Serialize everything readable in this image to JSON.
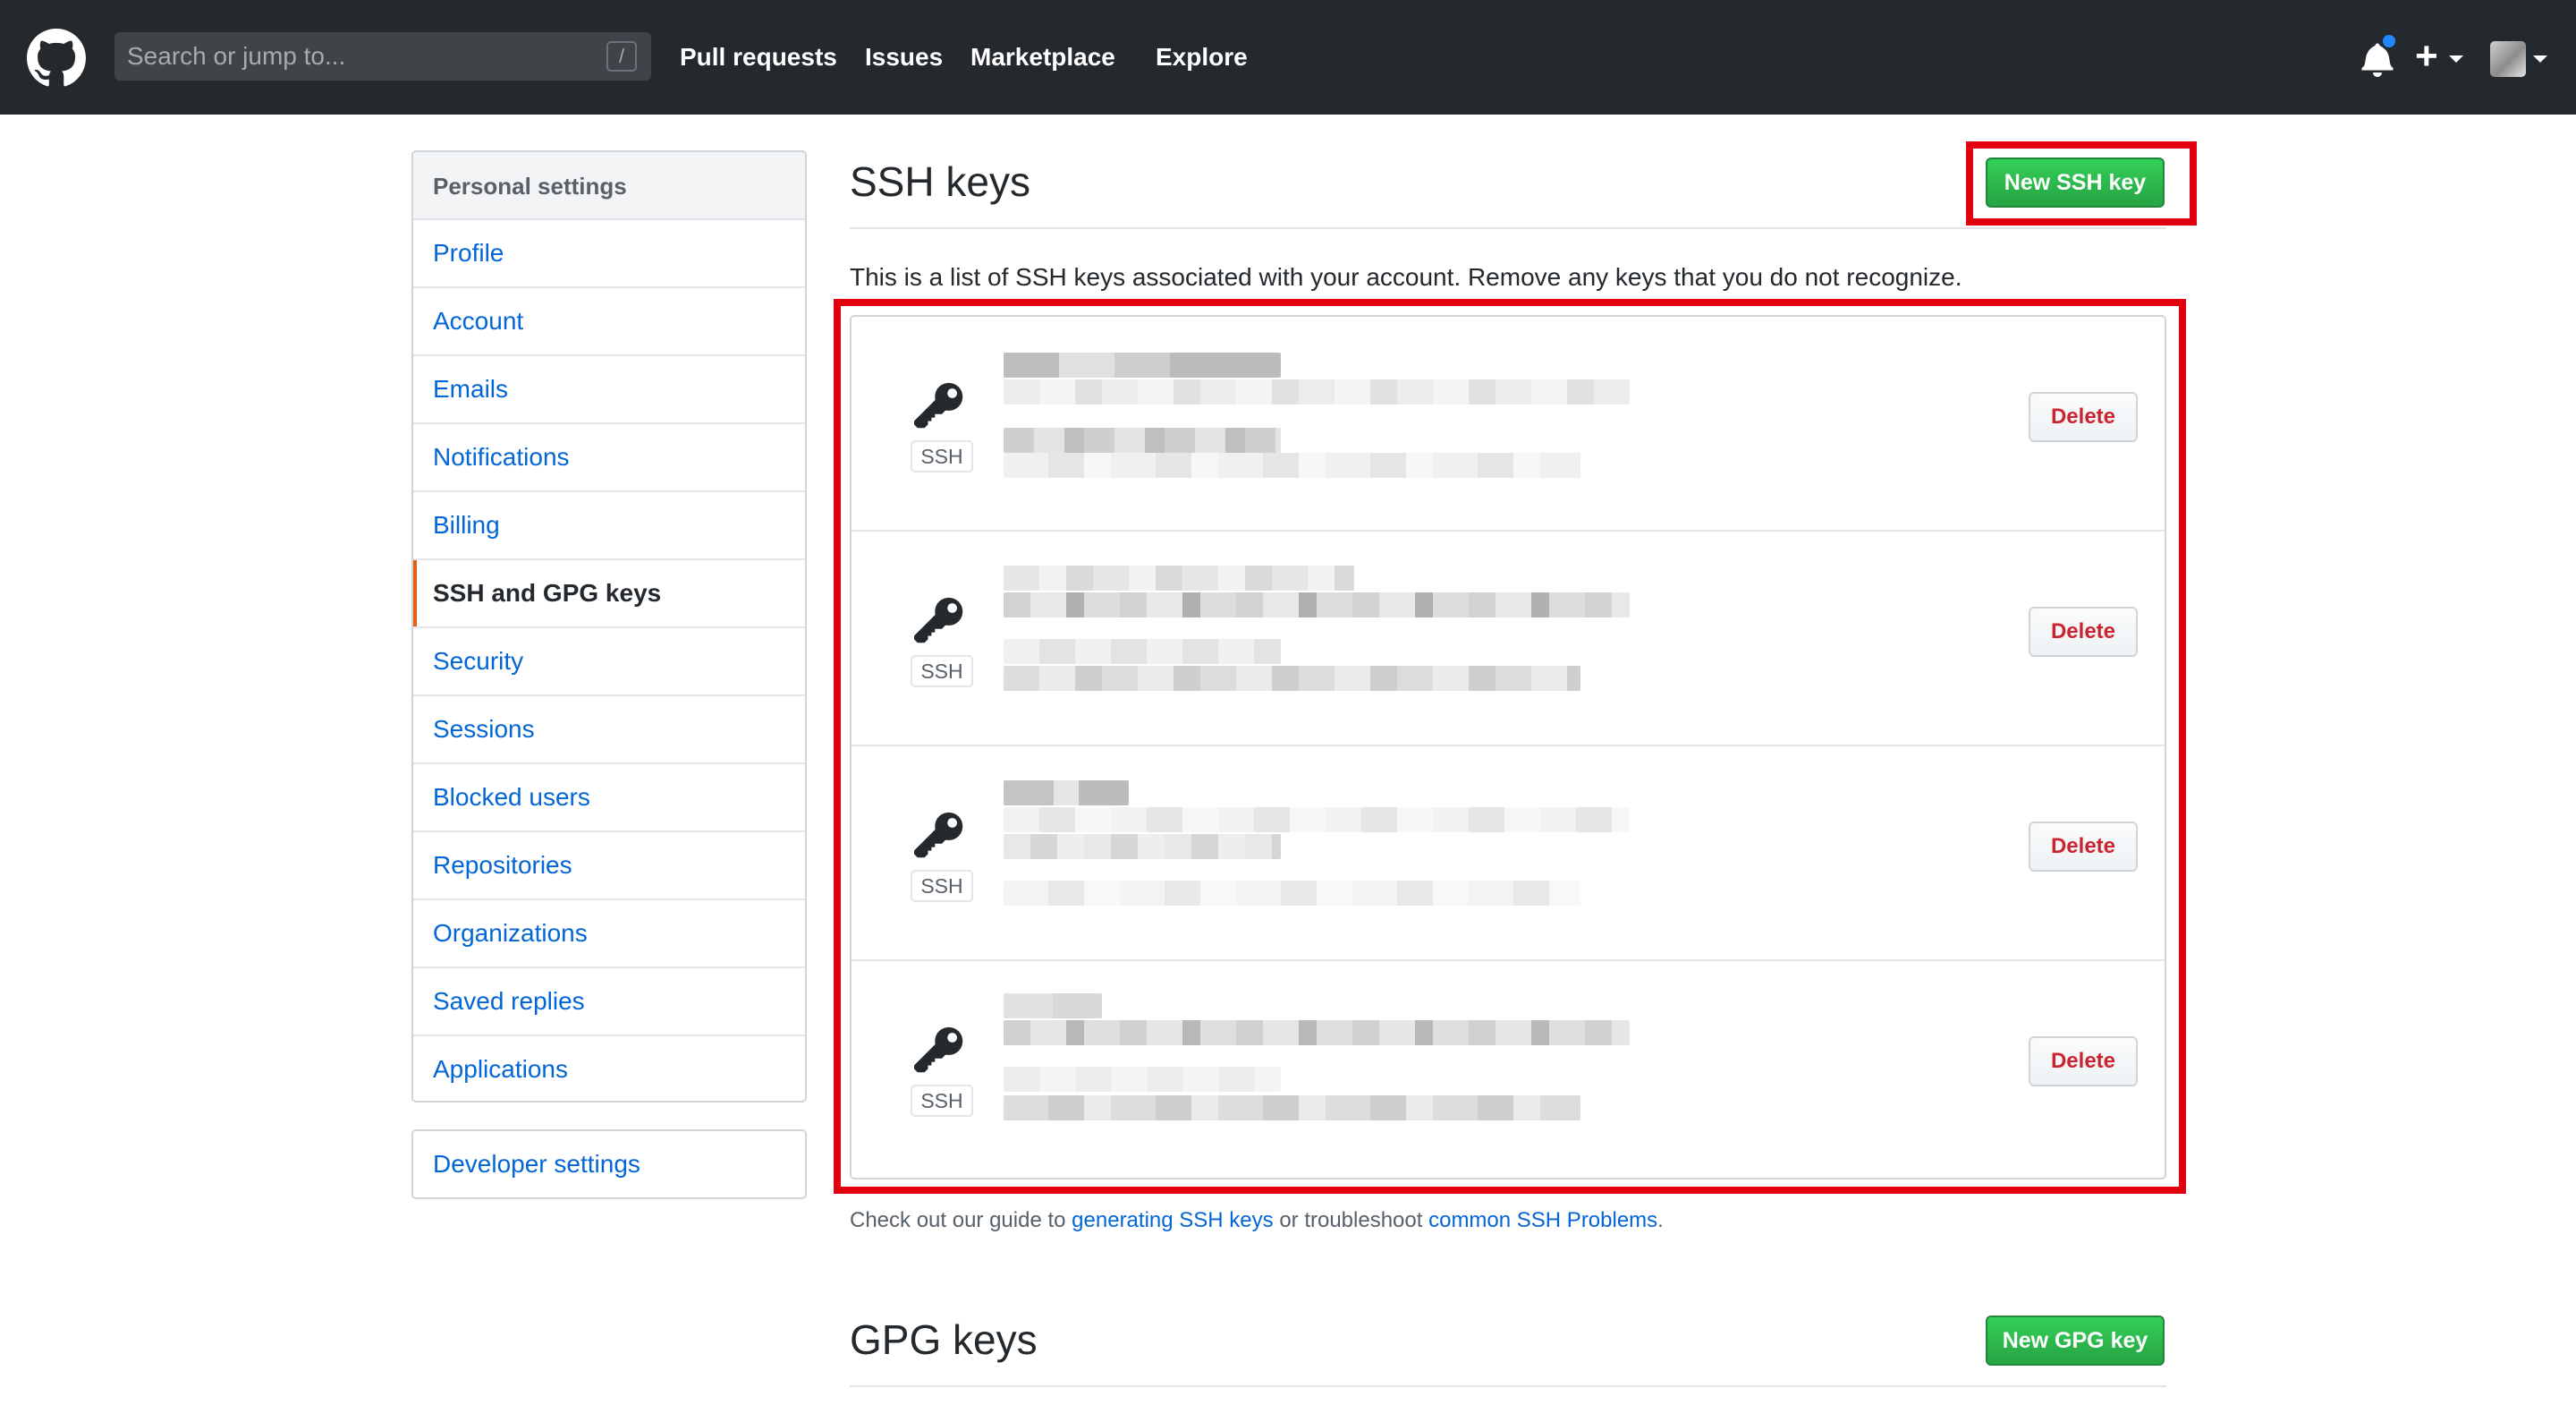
{
  "header": {
    "search_placeholder": "Search or jump to...",
    "slash_hint": "/",
    "nav": [
      "Pull requests",
      "Issues",
      "Marketplace",
      "Explore"
    ],
    "plus_label": "+"
  },
  "sidebar": {
    "heading": "Personal settings",
    "items": [
      "Profile",
      "Account",
      "Emails",
      "Notifications",
      "Billing",
      "SSH and GPG keys",
      "Security",
      "Sessions",
      "Blocked users",
      "Repositories",
      "Organizations",
      "Saved replies",
      "Applications"
    ],
    "selected": "SSH and GPG keys",
    "developer_settings": "Developer settings"
  },
  "ssh": {
    "title": "SSH keys",
    "new_button": "New SSH key",
    "intro": "This is a list of SSH keys associated with your account. Remove any keys that you do not recognize.",
    "keys": [
      {
        "type": "SSH",
        "delete_label": "Delete"
      },
      {
        "type": "SSH",
        "delete_label": "Delete"
      },
      {
        "type": "SSH",
        "delete_label": "Delete"
      },
      {
        "type": "SSH",
        "delete_label": "Delete"
      }
    ],
    "guide_prefix": "Check out our guide to",
    "guide_link1": "generating SSH keys",
    "guide_middle": "or troubleshoot",
    "guide_link2": "common SSH Problems",
    "guide_suffix": "."
  },
  "gpg": {
    "title": "GPG keys",
    "new_button": "New GPG key"
  },
  "colors": {
    "header_bg": "#24292e",
    "link": "#0366d6",
    "primary_green": "#28a745",
    "danger_red": "#cb2431",
    "highlight_red": "#e2000f",
    "selected_accent": "#e36209"
  }
}
